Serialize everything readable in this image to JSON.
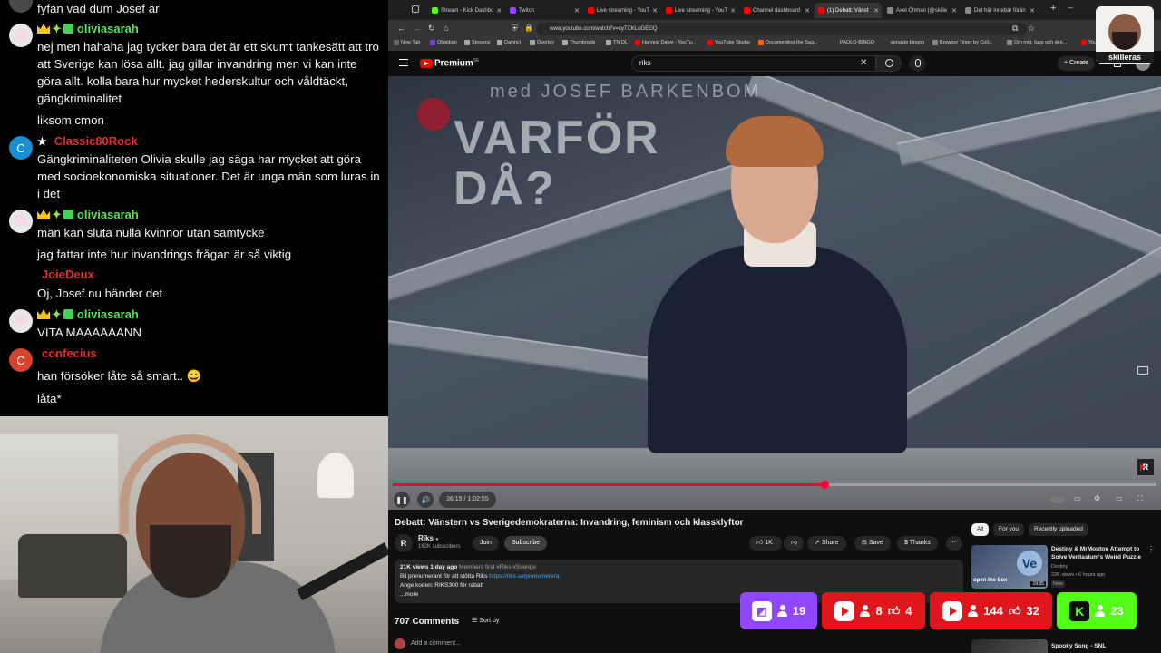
{
  "chat": {
    "messages": [
      {
        "user": "",
        "text": "fyfan vad dum Josef är"
      },
      {
        "user": "oliviasarah",
        "user_color": "#5ce05c",
        "text": "nej men hahaha jag tycker bara det är ett skumt tankesätt att tro att Sverige kan lösa allt. jag gillar invandring men vi kan inte göra allt. kolla bara hur mycket hederskultur och våldtäckt, gängkriminalitet"
      },
      {
        "user": "",
        "text": "liksom cmon"
      },
      {
        "user": "Classic80Rock",
        "user_color": "#e52b2b",
        "avatar_letter": "C",
        "text": "Gängkriminaliteten Olivia skulle jag säga har mycket att göra med socioekonomiska situationer. Det är unga män som luras in i det"
      },
      {
        "user": "oliviasarah",
        "user_color": "#5ce05c",
        "text": "män kan sluta nulla kvinnor utan samtycke"
      },
      {
        "user": "",
        "text": "jag fattar inte hur invandrings frågan är så viktig"
      },
      {
        "user": "JoieDeux",
        "user_color": "#e52b2b",
        "text": "Oj, Josef nu händer det"
      },
      {
        "user": "oliviasarah",
        "user_color": "#5ce05c",
        "text": "VITA MÄÄÄÄÄÄNN"
      },
      {
        "user": "confecius",
        "user_color": "#e52b2b",
        "avatar_letter": "C",
        "text": "han försöker låte så smart.. 😀"
      },
      {
        "user": "",
        "text": "låta*"
      }
    ]
  },
  "browser": {
    "tabs": [
      {
        "title": "Stream - Kick Dashbo",
        "icon_color": "#53fc18"
      },
      {
        "title": "Twitch",
        "icon_color": "#9146ff"
      },
      {
        "title": "Live streaming - YouT",
        "icon_color": "#ff0000"
      },
      {
        "title": "Live streaming - YouT",
        "icon_color": "#ff0000"
      },
      {
        "title": "Channel dashboard",
        "icon_color": "#ff0000"
      },
      {
        "title": "(1) Debatt: Vänst",
        "icon_color": "#ff0000"
      },
      {
        "title": "Axel Öhman (@skille",
        "icon_color": "#888888"
      },
      {
        "title": "Det här innebär förän",
        "icon_color": "#888888"
      }
    ],
    "url": "www.youtube.com/watch?v=cyTCKLuGEGQ",
    "bookmarks": [
      "New Tab",
      "Obsidian",
      "Streams",
      "Davinci",
      "Overlay",
      "Thumbnails",
      "TN DL",
      "Harvest Dawn - YouTu...",
      "YouTube Studio",
      "Documenting the Sag...",
      "PAOLO-BINGO",
      "senaste bingon",
      "Browser Timer by Coll...",
      "Om mig, tags och des...",
      "You"
    ]
  },
  "youtube": {
    "brand": "Premium",
    "brand_sup": "SE",
    "search_value": "riks",
    "create_label": "Create",
    "video": {
      "overlay_subtitle": "med JOSEF BARKENBOM",
      "overlay_title_line1": "VARFÖR",
      "overlay_title_line2": "DÅ?",
      "time": "36:15 / 1:02:55",
      "progress": 0.565,
      "riks_mark": "R"
    },
    "title": "Debatt: Vänstern vs Sverigedemokraterna: Invandring, feminism och klassklyftor",
    "channel": {
      "name": "Riks",
      "subs": "162K subscribers",
      "avatar": "R"
    },
    "join_label": "Join",
    "subscribe_label": "Subscribe",
    "actions": {
      "likes": "1K",
      "share": "Share",
      "save": "Save",
      "thanks": "Thanks",
      "more": "⋯"
    },
    "description": {
      "meta": "21K views  1 day ago",
      "tags": "Members first #Riks #Sverige",
      "line1": "Bli prenumerant för att stötta Riks ",
      "link": "https://riks.se/prenumerera",
      "line2": "Ange koden: RIKS300 för rabatt",
      "more": "...more"
    },
    "comments_count": "707 Comments",
    "sort_by": "Sort by",
    "add_comment": "Add a comment...",
    "chips": [
      "All",
      "For you",
      "Recently uploaded"
    ],
    "recommended": [
      {
        "title": "Destiny & MrMouton Attempt to Solve Veritasium's Weird Puzzle",
        "channel": "Destiny",
        "meta": "22K views • 6 hours ago",
        "badge": "New",
        "duration": "19:35",
        "thumb_text": "open the box"
      },
      {
        "title": "Spooky Song - SNL",
        "channel": "",
        "meta": "",
        "badge": "",
        "duration": "",
        "thumb_text": ""
      }
    ]
  },
  "overlay": {
    "logo_text": "skilleras",
    "viewers": [
      {
        "platform": "twitch",
        "viewers": "19",
        "likes": ""
      },
      {
        "platform": "youtube",
        "viewers": "8",
        "likes": "4"
      },
      {
        "platform": "youtube",
        "viewers": "144",
        "likes": "32"
      },
      {
        "platform": "kick",
        "viewers": "23",
        "likes": ""
      }
    ]
  }
}
